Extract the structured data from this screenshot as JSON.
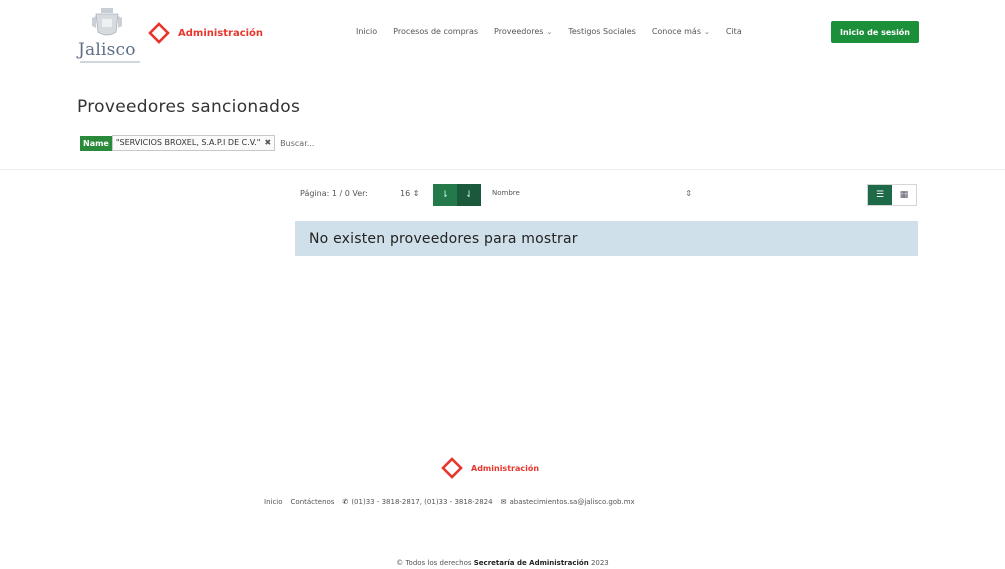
{
  "header": {
    "brand_text": "Jalisco",
    "admin_text": "Administración",
    "nav": [
      {
        "label": "Inicio",
        "caret": false
      },
      {
        "label": "Procesos de compras",
        "caret": false
      },
      {
        "label": "Proveedores",
        "caret": true
      },
      {
        "label": "Testigos Sociales",
        "caret": false
      },
      {
        "label": "Conoce más",
        "caret": true
      },
      {
        "label": "Cita",
        "caret": false
      }
    ],
    "login_label": "Inicio de sesión",
    "accent_color": "#1c8f3b",
    "brand_color": "#e8362d"
  },
  "main": {
    "title": "Proveedores sancionados",
    "filter": {
      "label": "Name",
      "value": "\"SERVICIOS BROXEL, S.A.P.I DE C.V.\"",
      "search_placeholder": "Buscar..."
    },
    "toolbar": {
      "pagina": "Página: 1 / 0 Ver:",
      "per_page": "16",
      "sort_field": "Nombre"
    },
    "empty_message": "No existen proveedores para mostrar"
  },
  "footer": {
    "admin_text": "Administración",
    "link_inicio": "Inicio",
    "link_contacto": "Contáctenos",
    "phone": "(01)33 - 3818-2817, (01)33 - 3818-2824",
    "email": "abastecimientos.sa@jalisco.gob.mx",
    "copy_prefix": "© Todos los derechos",
    "copy_org": "Secretaría de Administración",
    "copy_year": "2023"
  }
}
